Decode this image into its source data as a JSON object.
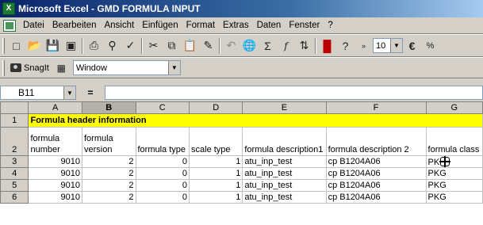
{
  "window": {
    "title": "Microsoft Excel - GMD FORMULA INPUT"
  },
  "menu": [
    "Datei",
    "Bearbeiten",
    "Ansicht",
    "Einfügen",
    "Format",
    "Extras",
    "Daten",
    "Fenster",
    "?"
  ],
  "toolbar": {
    "zoom_value": "10",
    "currency_symbol": "€"
  },
  "snagit": {
    "label": "SnagIt",
    "window_value": "Window"
  },
  "formula_bar": {
    "name_box": "B11",
    "equals": "=",
    "content": ""
  },
  "sheet": {
    "column_headers": [
      "A",
      "B",
      "C",
      "D",
      "E",
      "F",
      "G"
    ],
    "row1": {
      "row": "1",
      "text": "Formula header information"
    },
    "row2": {
      "row": "2",
      "cells": [
        "formula number",
        "formula version",
        "formula type",
        "scale type",
        "formula description1",
        "formula description 2",
        "formula class"
      ]
    },
    "rows": [
      {
        "row": "3",
        "a": "9010",
        "b": "2",
        "c": "0",
        "d": "1",
        "e": "atu_inp_test",
        "f": "cp B1204A06",
        "g": "PK"
      },
      {
        "row": "4",
        "a": "9010",
        "b": "2",
        "c": "0",
        "d": "1",
        "e": "atu_inp_test",
        "f": "cp B1204A06",
        "g": "PKG"
      },
      {
        "row": "5",
        "a": "9010",
        "b": "2",
        "c": "0",
        "d": "1",
        "e": "atu_inp_test",
        "f": "cp B1204A06",
        "g": "PKG"
      },
      {
        "row": "6",
        "a": "9010",
        "b": "2",
        "c": "0",
        "d": "1",
        "e": "atu_inp_test",
        "f": "cp B1204A06",
        "g": "PKG"
      }
    ]
  },
  "colors": {
    "title_bar": "#0a246a",
    "highlight_row": "#ffff00",
    "excel_green": "#1e7b34"
  }
}
